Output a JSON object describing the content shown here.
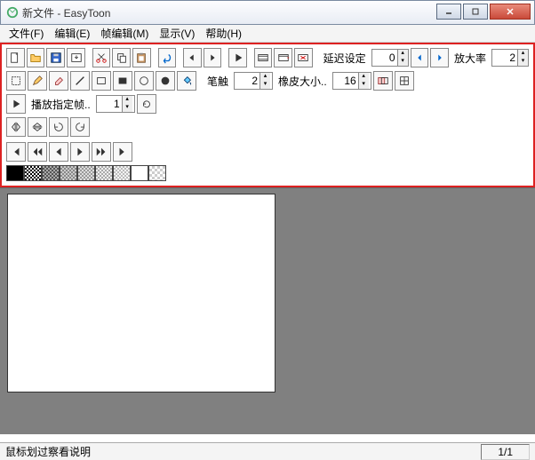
{
  "window": {
    "title": "新文件 - EasyToon"
  },
  "menu": {
    "file": "文件(F)",
    "edit": "编辑(E)",
    "frame": "帧编辑(M)",
    "view": "显示(V)",
    "help": "帮助(H)"
  },
  "toolbar1": {
    "delay_label": "延迟设定",
    "delay_value": "0",
    "zoom_label": "放大率",
    "zoom_value": "2"
  },
  "toolbar2": {
    "brush_label": "笔触",
    "brush_value": "2",
    "eraser_label": "橡皮大小..",
    "eraser_value": "16"
  },
  "toolbar3": {
    "playframe_label": "播放指定帧..",
    "playframe_value": "1"
  },
  "status": {
    "hint": "鼠标划过察看说明",
    "frame": "1/1"
  }
}
